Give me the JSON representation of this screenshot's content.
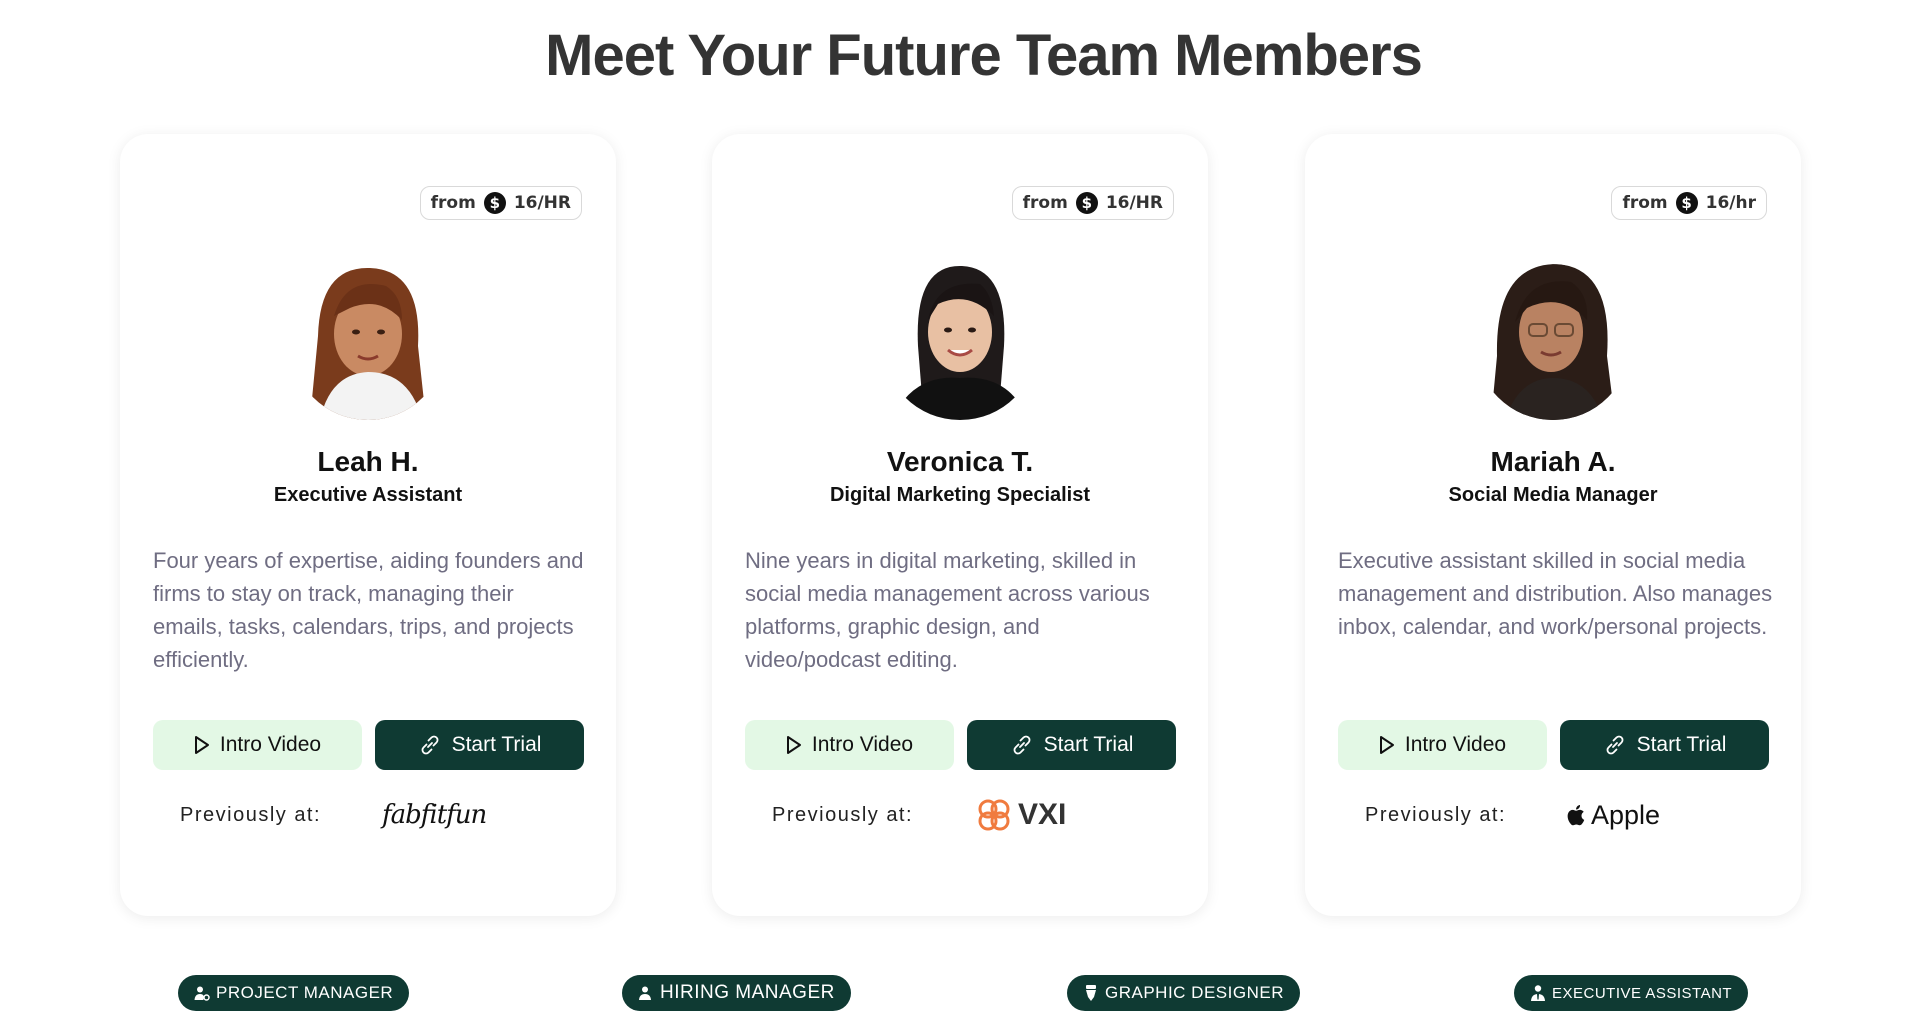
{
  "page": {
    "title": "Meet Your Future Team Members"
  },
  "colors": {
    "accent_dark": "#0f3a33",
    "accent_light": "#e3f8e5",
    "bio_text": "#6f6d82"
  },
  "buttons": {
    "intro_label": "Intro Video",
    "trial_label": "Start Trial"
  },
  "previously_label": "Previously at:",
  "members": [
    {
      "rate_prefix": "from",
      "rate_value": "16/HR",
      "name": "Leah H.",
      "role": "Executive Assistant",
      "bio": "Four years of expertise, aiding founders and firms to stay on track, managing their emails, tasks, calendars, trips, and projects efficiently.",
      "previous_company": "fabfitfun"
    },
    {
      "rate_prefix": "from",
      "rate_value": "16/HR",
      "name": "Veronica T.",
      "role": "Digital Marketing Specialist",
      "bio": "Nine years in digital marketing, skilled in social media management across various platforms, graphic design, and video/podcast editing.",
      "previous_company": "VXI"
    },
    {
      "rate_prefix": "from",
      "rate_value": "16/hr",
      "name": "Mariah A.",
      "role": "Social Media Manager",
      "bio": "Executive assistant skilled in social media management and distribution. Also manages inbox, calendar, and work/personal projects.",
      "previous_company": "Apple"
    }
  ],
  "tags": [
    "PROJECT MANAGER",
    "HIRING MANAGER",
    "GRAPHIC DESIGNER",
    "EXECUTIVE ASSISTANT"
  ],
  "icons": {
    "dollar": "$",
    "intro": "play-icon",
    "trial": "link-icon",
    "tag1": "person-gear-icon",
    "tag2": "person-icon",
    "tag3": "pen-nib-icon",
    "tag4": "person-tie-icon"
  }
}
